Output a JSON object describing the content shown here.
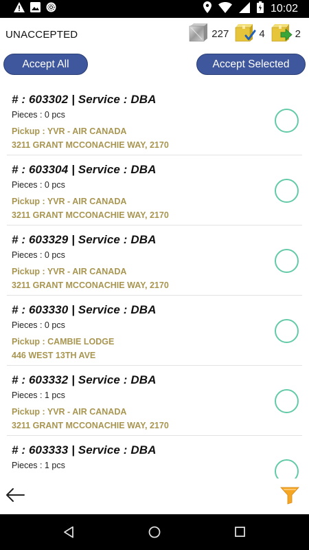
{
  "status_bar": {
    "time": "10:02",
    "left_icons": [
      "alert-icon",
      "image-icon",
      "sync-icon"
    ],
    "right_icons": [
      "location-icon",
      "wifi-icon",
      "signal-icon",
      "battery-icon"
    ]
  },
  "header": {
    "title": "UNACCEPTED",
    "counters": [
      {
        "icon": "box-icon",
        "value": "227"
      },
      {
        "icon": "box-check-icon",
        "value": "4"
      },
      {
        "icon": "box-arrow-icon",
        "value": "2"
      }
    ]
  },
  "actions": {
    "accept_all": "Accept All",
    "accept_selected": "Accept Selected"
  },
  "orders": [
    {
      "title": "# : 603302  |  Service : DBA",
      "pieces": "Pieces : 0 pcs",
      "pickup": "Pickup : YVR - AIR CANADA",
      "address": "3211 GRANT MCCONACHIE WAY, 2170",
      "selected": false
    },
    {
      "title": "# : 603304  |  Service : DBA",
      "pieces": "Pieces : 0 pcs",
      "pickup": "Pickup : YVR - AIR CANADA",
      "address": "3211 GRANT MCCONACHIE WAY, 2170",
      "selected": false
    },
    {
      "title": "# : 603329  |  Service : DBA",
      "pieces": "Pieces : 0 pcs",
      "pickup": "Pickup : YVR - AIR CANADA",
      "address": "3211 GRANT MCCONACHIE WAY, 2170",
      "selected": false
    },
    {
      "title": "# : 603330  |  Service : DBA",
      "pieces": "Pieces : 0 pcs",
      "pickup": "Pickup : CAMBIE LODGE",
      "address": "446 WEST 13TH AVE",
      "selected": false
    },
    {
      "title": "# : 603332  |  Service : DBA",
      "pieces": "Pieces : 1 pcs",
      "pickup": "Pickup : YVR - AIR CANADA",
      "address": "3211 GRANT MCCONACHIE WAY, 2170",
      "selected": false
    },
    {
      "title": "# : 603333  |  Service : DBA",
      "pieces": "Pieces : 1 pcs",
      "pickup": "",
      "address": "",
      "selected": false
    }
  ],
  "toolbar": {
    "back_icon": "arrow-left-icon",
    "filter_icon": "filter-icon"
  },
  "colors": {
    "accent_button": "#3f579c",
    "pickup_text": "#a89550",
    "check_circle": "#63caa8",
    "filter": "#f5a623"
  }
}
